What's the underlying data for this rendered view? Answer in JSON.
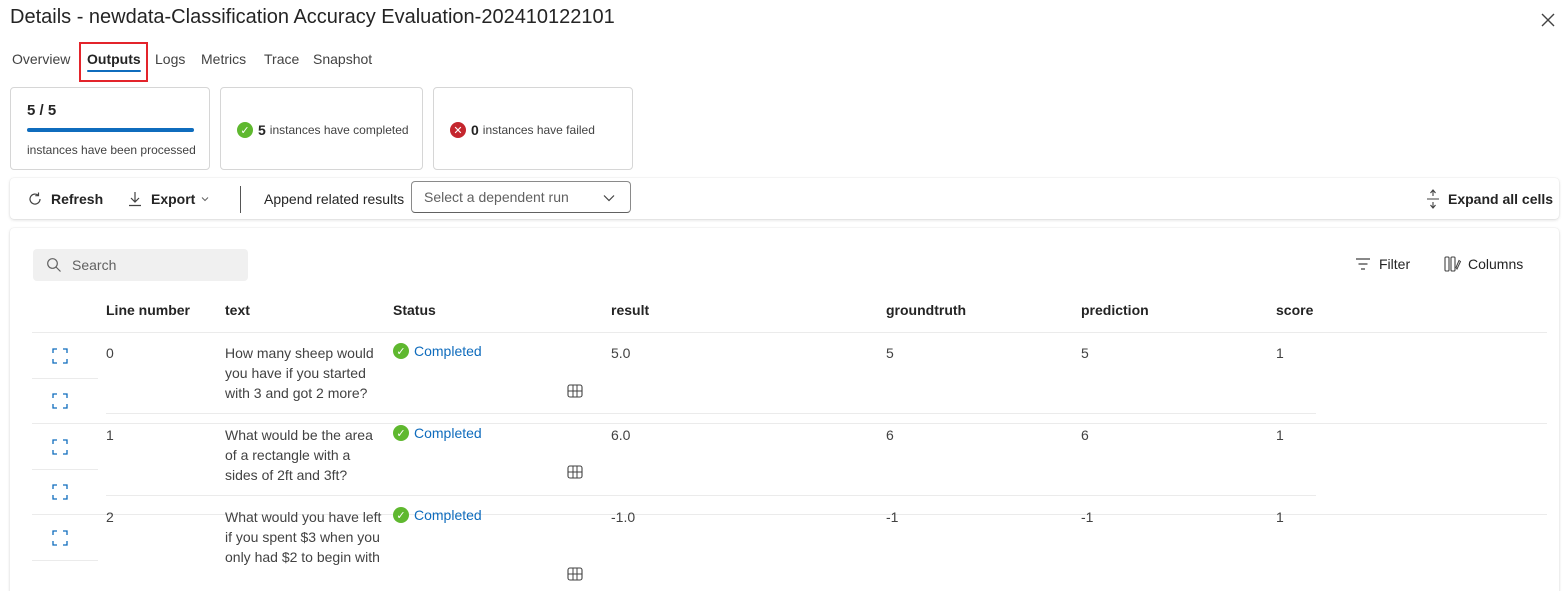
{
  "header": {
    "title": "Details - newdata-Classification Accuracy Evaluation-202410122101",
    "close_icon": "close-icon"
  },
  "tabs": [
    {
      "label": "Overview"
    },
    {
      "label": "Outputs",
      "active": true
    },
    {
      "label": "Logs"
    },
    {
      "label": "Metrics"
    },
    {
      "label": "Trace"
    },
    {
      "label": "Snapshot"
    }
  ],
  "summary": {
    "processed": {
      "value": "5 / 5",
      "label": "instances have been processed",
      "progress": 1.0
    },
    "completed": {
      "count": "5",
      "label": "instances have completed"
    },
    "failed": {
      "count": "0",
      "label": "instances have failed"
    }
  },
  "toolbar": {
    "refresh": "Refresh",
    "export": "Export",
    "append_label": "Append related results",
    "select_placeholder": "Select a dependent run",
    "expand_all": "Expand all cells"
  },
  "table": {
    "search_placeholder": "Search",
    "filter": "Filter",
    "columns_btn": "Columns",
    "headers": [
      "Line number",
      "text",
      "Status",
      "result",
      "groundtruth",
      "prediction",
      "score"
    ],
    "rows": [
      {
        "line": "0",
        "text": "How many sheep would you have if you started with 3 and got 2 more?",
        "status": "Completed",
        "result": "5.0",
        "groundtruth": "5",
        "prediction": "5",
        "score": "1"
      },
      {
        "line": "1",
        "text": "What would be the area of a rectangle with a sides of 2ft and 3ft?",
        "status": "Completed",
        "result": "6.0",
        "groundtruth": "6",
        "prediction": "6",
        "score": "1"
      },
      {
        "line": "2",
        "text": "What would you have left if you spent $3 when you only had $2 to begin with",
        "status": "Completed",
        "result": "-1.0",
        "groundtruth": "-1",
        "prediction": "-1",
        "score": "1"
      }
    ]
  },
  "colors": {
    "accent": "#0f6cbd",
    "success": "#5fb82f",
    "error": "#c4262e",
    "highlight": "#e3242b"
  }
}
